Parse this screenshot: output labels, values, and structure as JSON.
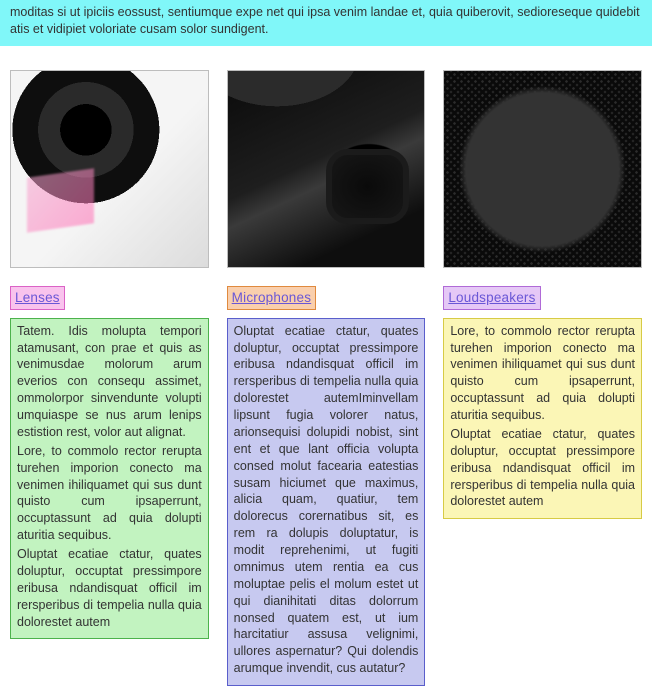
{
  "banner": {
    "text": "moditas si ut ipiciis eossust, sentiumque expe net qui ipsa venim landae et, quia quiberovit, sedioreseque quidebit atis et vidipiet voloriate cusam solor sundigent."
  },
  "columns": [
    {
      "heading": "Lenses",
      "body_p1": "Tatem. Idis molupta tempori atamusant, con prae et quis as venimusdae molo­rum arum everios con consequ assimet, ommolorpor sinvendunte volupti umqui­aspe se nus arum lenips estistion rest, volor aut alignat.",
      "body_p2": "Lore, to commolo rector rerupta turehen imporion conecto ma venimen ihiliqua­met qui sus dunt quisto cum ipsaper­runt, occuptassunt ad quia dolupti aturitia sequibus.",
      "body_p3": "Oluptat ecatiae ctatur, quates doluptur, occuptat pressimpore eribusa ndandis­quat officil im rersperibus di tempelia nulla quia dolorestet autem"
    },
    {
      "heading": "Microphones",
      "body_p1": "Oluptat ecatiae ctatur, quates doluptur, occuptat pressimpore eribusa ndandis­quat officil im rersperibus di tempelia nulla quia dolorestet autemIminvellam lipsunt fugia volorer natus, arionsequisi dolupidi nobist, sint ent et que lant officia volupta consed molut facearia eatestias susam hiciumet que maximus, alicia quam, quatiur, tem dolorecus corernatibus sit, es rem ra dolupis do­luptatur, is modit reprehenimi, ut fugiti omnimus utem rentia ea cus moluptae pelis el molum estet ut qui dianihitati ditas dolorrum nonsed quatem est, ut ium harcitatiur assusa velignimi, ullores aspernatur? Qui dolendis arumque invendit, cus autatur?"
    },
    {
      "heading": "Loudspeakers",
      "body_p1": "Lore, to commolo rector rerupta turehen imporion conecto ma venimen ihiliqua­met qui sus dunt quisto cum ipsaper­runt, occuptassunt ad quia dolupti aturitia sequibus.",
      "body_p2": "Oluptat ecatiae ctatur, quates doluptur, occuptat pressimpore eribusa ndandis­quat officil im rersperibus di tempelia nulla quia dolorestet autem"
    }
  ]
}
